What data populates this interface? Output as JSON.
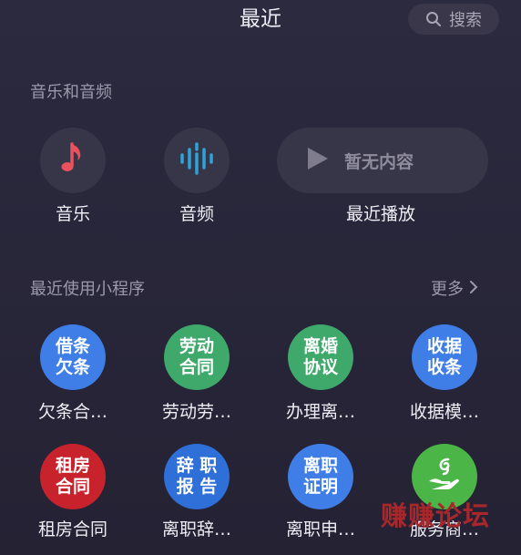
{
  "header": {
    "title": "最近",
    "search_label": "搜索"
  },
  "media": {
    "section_title": "音乐和音频",
    "items": [
      {
        "label": "音乐",
        "icon": "music-note-icon",
        "color": "#e8515d"
      },
      {
        "label": "音频",
        "icon": "audio-wave-icon",
        "color": "#2ea3d8"
      }
    ],
    "recent_play": {
      "empty_text": "暂无内容",
      "label": "最近播放"
    }
  },
  "mini_programs": {
    "section_title": "最近使用小程序",
    "more_label": "更多",
    "items": [
      {
        "icon_line1": "借条",
        "icon_line2": "欠条",
        "label": "欠条合…",
        "color": "#3f7ee6"
      },
      {
        "icon_line1": "劳动",
        "icon_line2": "合同",
        "label": "劳动劳…",
        "color": "#3ea96b"
      },
      {
        "icon_line1": "离婚",
        "icon_line2": "协议",
        "label": "办理离…",
        "color": "#3ea96b"
      },
      {
        "icon_line1": "收据",
        "icon_line2": "收条",
        "label": "收据模…",
        "color": "#3f7ee6"
      },
      {
        "icon_line1": "租房",
        "icon_line2": "合同",
        "label": "租房合同",
        "color": "#c8232c"
      },
      {
        "icon_line1": "辞 职",
        "icon_line2": "报 告",
        "label": "离职辞…",
        "color": "#2f6fd8"
      },
      {
        "icon_line1": "离职",
        "icon_line2": "证明",
        "label": "离职申…",
        "color": "#3f7ee6"
      },
      {
        "icon_line1": "",
        "icon_line2": "",
        "label": "服务商…",
        "color": "#4cb548"
      }
    ]
  },
  "watermark": "赚赚论坛"
}
